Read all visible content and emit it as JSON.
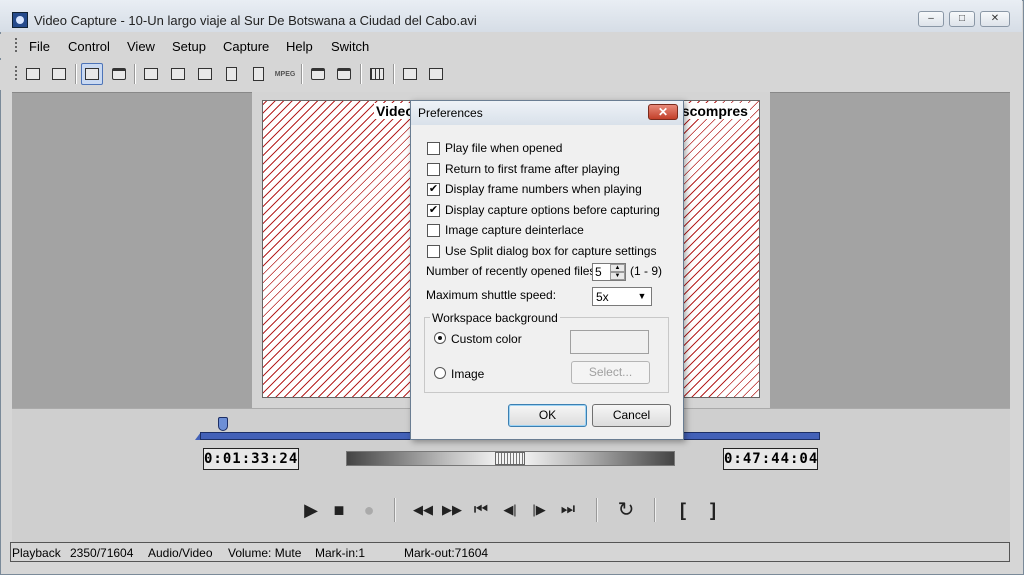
{
  "window": {
    "title": "Video Capture - 10-Un largo viaje al Sur De Botswana a Ciudad del Cabo.avi",
    "minimize": "–",
    "maximize": "□",
    "close": "✕"
  },
  "menu": {
    "file": "File",
    "control": "Control",
    "view": "View",
    "setup": "Setup",
    "capture": "Capture",
    "help": "Help",
    "switch": "Switch"
  },
  "toolbar": {
    "mpeg_label": "MPEG"
  },
  "video": {
    "caption_left": "Video",
    "caption_right": "escompres"
  },
  "timeline": {
    "current_time": "0:01:33:24",
    "total_time": "0:47:44:04"
  },
  "transport": {
    "play": "▶",
    "stop": "■",
    "record": "●",
    "rewind": "◀◀",
    "fast_forward": "▶▶",
    "first_frame": "⏮",
    "prev_frame": "◀|",
    "next_frame": "|▶",
    "last_frame": "⏭",
    "loop": "↻",
    "mark_in": "[",
    "mark_out": "]"
  },
  "status": {
    "mode": "Playback",
    "frame": "2350/71604",
    "stream": "Audio/Video",
    "volume": "Volume: Mute",
    "mark_in": "Mark-in:1",
    "mark_out": "Mark-out:71604"
  },
  "dialog": {
    "title": "Preferences",
    "close": "✕",
    "options": [
      {
        "label": "Play file when opened",
        "checked": false
      },
      {
        "label": "Return to first frame after playing",
        "checked": false
      },
      {
        "label": "Display frame numbers when playing",
        "checked": true
      },
      {
        "label": "Display capture options before capturing",
        "checked": true
      },
      {
        "label": "Image capture deinterlace",
        "checked": false
      },
      {
        "label": "Use Split dialog box for capture settings",
        "checked": false
      }
    ],
    "check_mark": "✔",
    "recent_files_label": "Number of recently opened files:",
    "recent_files_value": "5",
    "recent_files_range": "(1 - 9)",
    "shuttle_speed_label": "Maximum shuttle speed:",
    "shuttle_speed_value": "5x",
    "workspace_group": "Workspace background",
    "custom_color_label": "Custom color",
    "image_label": "Image",
    "select_button": "Select...",
    "ok_button": "OK",
    "cancel_button": "Cancel"
  }
}
